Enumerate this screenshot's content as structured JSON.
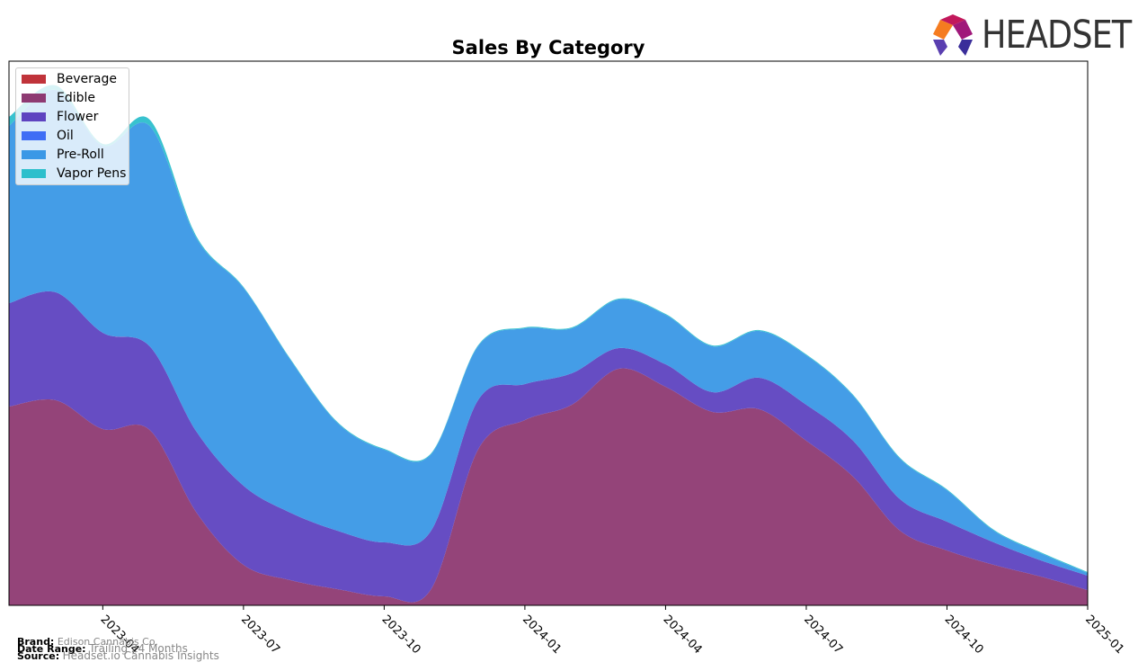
{
  "logo_text": "HEADSET",
  "chart_data": {
    "type": "area",
    "stacked": true,
    "title": "Sales By Category",
    "xlabel": "",
    "ylabel": "",
    "x": [
      "2023-02",
      "2023-03",
      "2023-04",
      "2023-05",
      "2023-06",
      "2023-07",
      "2023-08",
      "2023-09",
      "2023-10",
      "2023-11",
      "2023-12",
      "2024-01",
      "2024-02",
      "2024-03",
      "2024-04",
      "2024-05",
      "2024-06",
      "2024-07",
      "2024-08",
      "2024-09",
      "2024-10",
      "2024-11",
      "2024-12",
      "2025-01"
    ],
    "x_ticks": [
      "2023-04",
      "2023-07",
      "2023-10",
      "2024-01",
      "2024-04",
      "2024-07",
      "2024-10",
      "2025-01"
    ],
    "ylim": [
      0,
      605
    ],
    "grid": false,
    "legend_position": "top-left",
    "series": [
      {
        "name": "Beverage",
        "color": "#c0333a",
        "values": [
          0,
          0,
          0,
          0,
          0,
          0,
          0,
          0,
          0,
          0,
          0,
          0,
          0,
          0,
          0,
          0,
          0,
          0,
          0,
          0,
          0,
          0,
          0,
          0
        ]
      },
      {
        "name": "Edible",
        "color": "#8e3a72",
        "values": [
          221,
          228,
          196,
          195,
          103,
          45,
          28,
          18,
          10,
          18,
          173,
          206,
          223,
          263,
          243,
          215,
          218,
          183,
          143,
          83,
          61,
          45,
          32,
          17
        ]
      },
      {
        "name": "Flower",
        "color": "#5e43c0",
        "values": [
          115,
          120,
          107,
          93,
          90,
          88,
          75,
          65,
          60,
          65,
          55,
          40,
          35,
          23,
          25,
          22,
          35,
          40,
          40,
          35,
          32,
          25,
          18,
          16
        ]
      },
      {
        "name": "Oil",
        "color": "#3f6ef5",
        "values": [
          0,
          0,
          0,
          0,
          0,
          0,
          0,
          0,
          0,
          0,
          0,
          0,
          0,
          0,
          0,
          0,
          0,
          0,
          0,
          0,
          0,
          0,
          0,
          0
        ]
      },
      {
        "name": "Pre-Roll",
        "color": "#3a98e6",
        "values": [
          197,
          225,
          208,
          245,
          215,
          220,
          170,
          120,
          103,
          85,
          60,
          62,
          50,
          54,
          55,
          51,
          52,
          55,
          50,
          45,
          35,
          13,
          8,
          3
        ]
      },
      {
        "name": "Vapor Pens",
        "color": "#2dbfcc",
        "values": [
          10,
          5,
          2,
          7,
          2,
          1,
          1,
          1,
          1,
          1,
          1,
          1,
          1,
          1,
          1,
          1,
          1,
          1,
          1,
          1,
          1,
          1,
          1,
          1
        ]
      }
    ]
  },
  "footer": {
    "brand_label": "Brand:",
    "brand_value": "Edison Cannabis Co.",
    "range_label": "Date Range:",
    "range_value": "Trailing 24 Months",
    "source_label": "Source:",
    "source_value": "Headset.io Cannabis Insights"
  }
}
